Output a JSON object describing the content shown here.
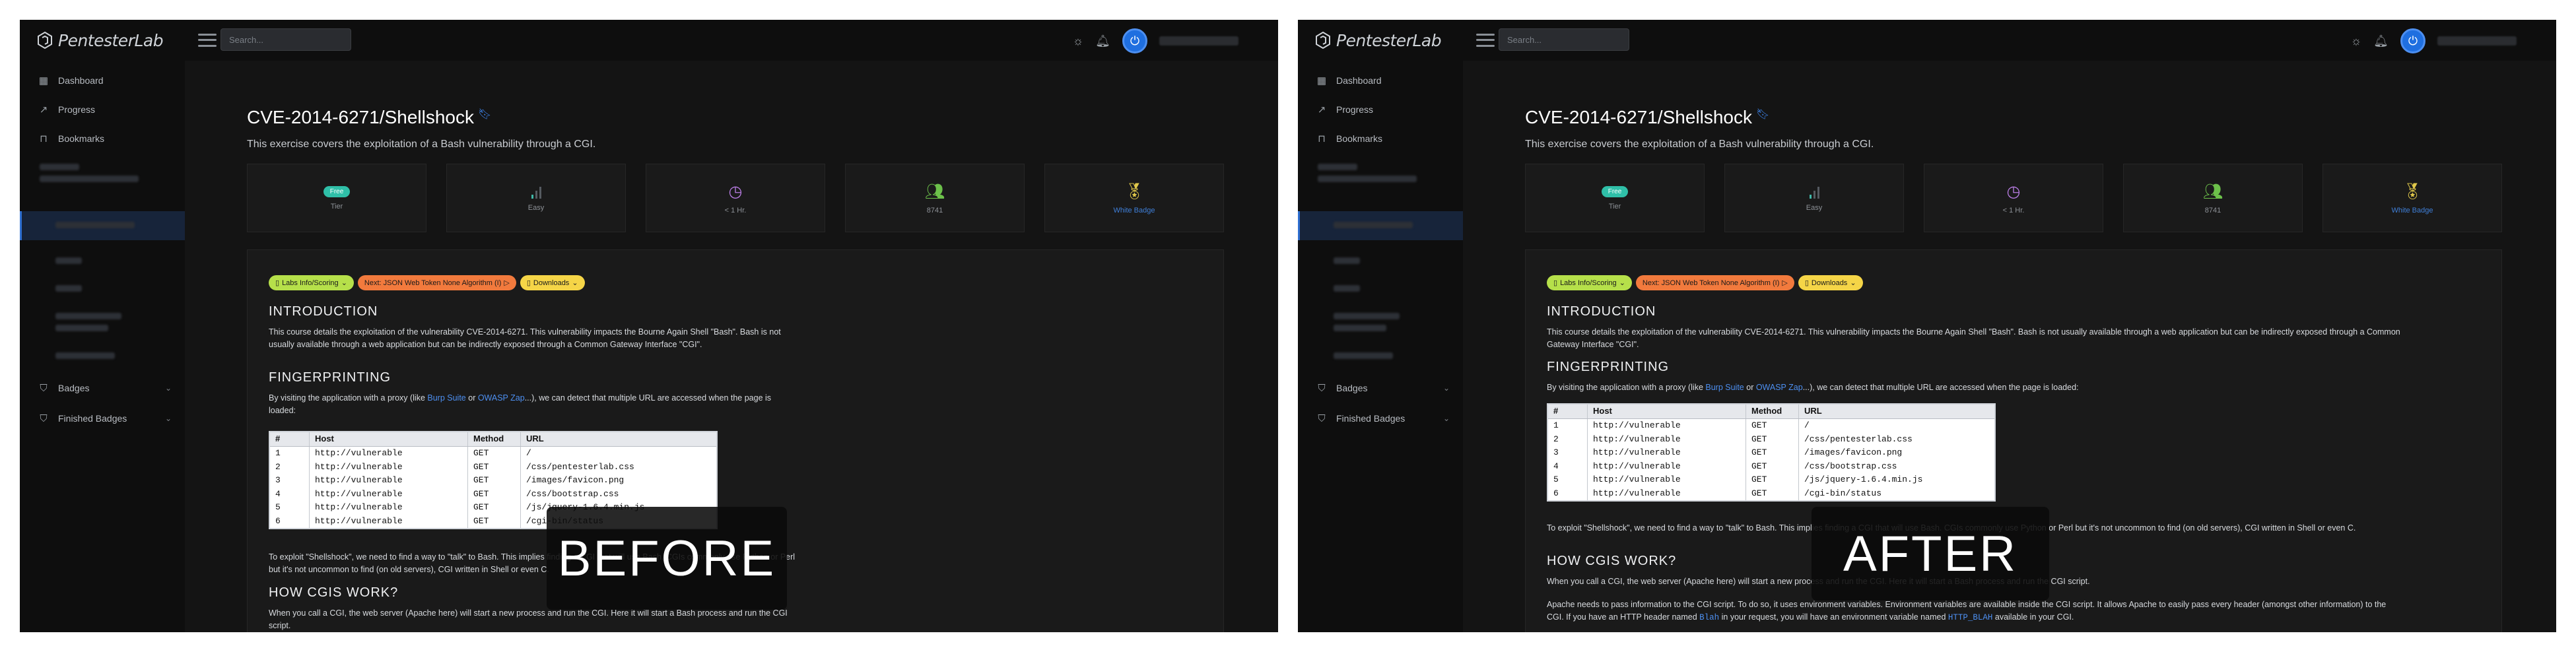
{
  "app": {
    "logo_text": "PentesterLab",
    "search_placeholder": "Search...",
    "colors": {
      "accent": "#2f6fd0",
      "link": "#4d8ff0",
      "background": "#141414",
      "sidebar": "#0e0e0e"
    }
  },
  "sidebar": {
    "items": [
      {
        "label": "Dashboard",
        "icon": "dashboard-icon"
      },
      {
        "label": "Progress",
        "icon": "chart-line-icon"
      },
      {
        "label": "Bookmarks",
        "icon": "bookmark-icon"
      }
    ],
    "bottom_items": [
      {
        "label": "Badges",
        "icon": "shield-icon"
      },
      {
        "label": "Finished Badges",
        "icon": "shield-check-icon"
      }
    ]
  },
  "page": {
    "title": "CVE-2014-6271/Shellshock",
    "subtitle": "This exercise covers the exploitation of a Bash vulnerability through a CGI.",
    "stats": [
      {
        "value": "Free",
        "label": "Tier"
      },
      {
        "label": "Easy"
      },
      {
        "label": "< 1 Hr."
      },
      {
        "label": "8741"
      },
      {
        "label": "White Badge"
      }
    ],
    "pills": [
      {
        "label": "Labs Info/Scoring",
        "color": "#b6e04a"
      },
      {
        "label": "Next: JSON Web Token None Algorithm (I)",
        "color": "#f27a3d"
      },
      {
        "label": "Downloads",
        "color": "#f5d547"
      }
    ],
    "intro": {
      "heading": "INTRODUCTION",
      "text": "This course details the exploitation of the vulnerability CVE-2014-6271. This vulnerability impacts the Bourne Again Shell \"Bash\". Bash is not usually available through a web application but can be indirectly exposed through a Common Gateway Interface \"CGI\"."
    },
    "fingerprinting": {
      "heading": "FINGERPRINTING",
      "text_before": "By visiting the application with a proxy (like ",
      "link1": "Burp Suite",
      "text_or": " or ",
      "link2": "OWASP Zap",
      "text_after": "...), we can detect that multiple URL are accessed when the page is loaded:"
    },
    "table": {
      "headers": [
        "#",
        "Host",
        "Method",
        "URL"
      ],
      "rows": [
        [
          "1",
          "http://vulnerable",
          "GET",
          "/"
        ],
        [
          "2",
          "http://vulnerable",
          "GET",
          "/css/pentesterlab.css"
        ],
        [
          "3",
          "http://vulnerable",
          "GET",
          "/images/favicon.png"
        ],
        [
          "4",
          "http://vulnerable",
          "GET",
          "/css/bootstrap.css"
        ],
        [
          "5",
          "http://vulnerable",
          "GET",
          "/js/jquery-1.6.4.min.js"
        ],
        [
          "6",
          "http://vulnerable",
          "GET",
          "/cgi-bin/status"
        ]
      ]
    },
    "exploit_text": "To exploit \"Shellshock\", we need to find a way to \"talk\" to Bash. This implies finding a CGI that will use Bash. CGIs commonly use Python or Perl but it's not uncommon to find (on old servers), CGI written in Shell or even C.",
    "cgi": {
      "heading": "HOW CGIS WORK?",
      "text": "When you call a CGI, the web server (Apache here) will start a new process and run the CGI. Here it will start a Bash process and run the CGI script.",
      "env_before": "Apache needs to pass information to the CGI script. To do so, it uses environment variables. Environment variables are available inside the CGI script. It allows Apache to easily pass every header (amongst other information) to the CGI. If you have an HTTP header named ",
      "env_code1": "Blah",
      "env_middle": " in your request, you will have an environment variable named ",
      "env_code2": "HTTP_BLAH",
      "env_after": " available in your CGI."
    }
  },
  "labels": {
    "before": "BEFORE",
    "after": "AFTER"
  }
}
